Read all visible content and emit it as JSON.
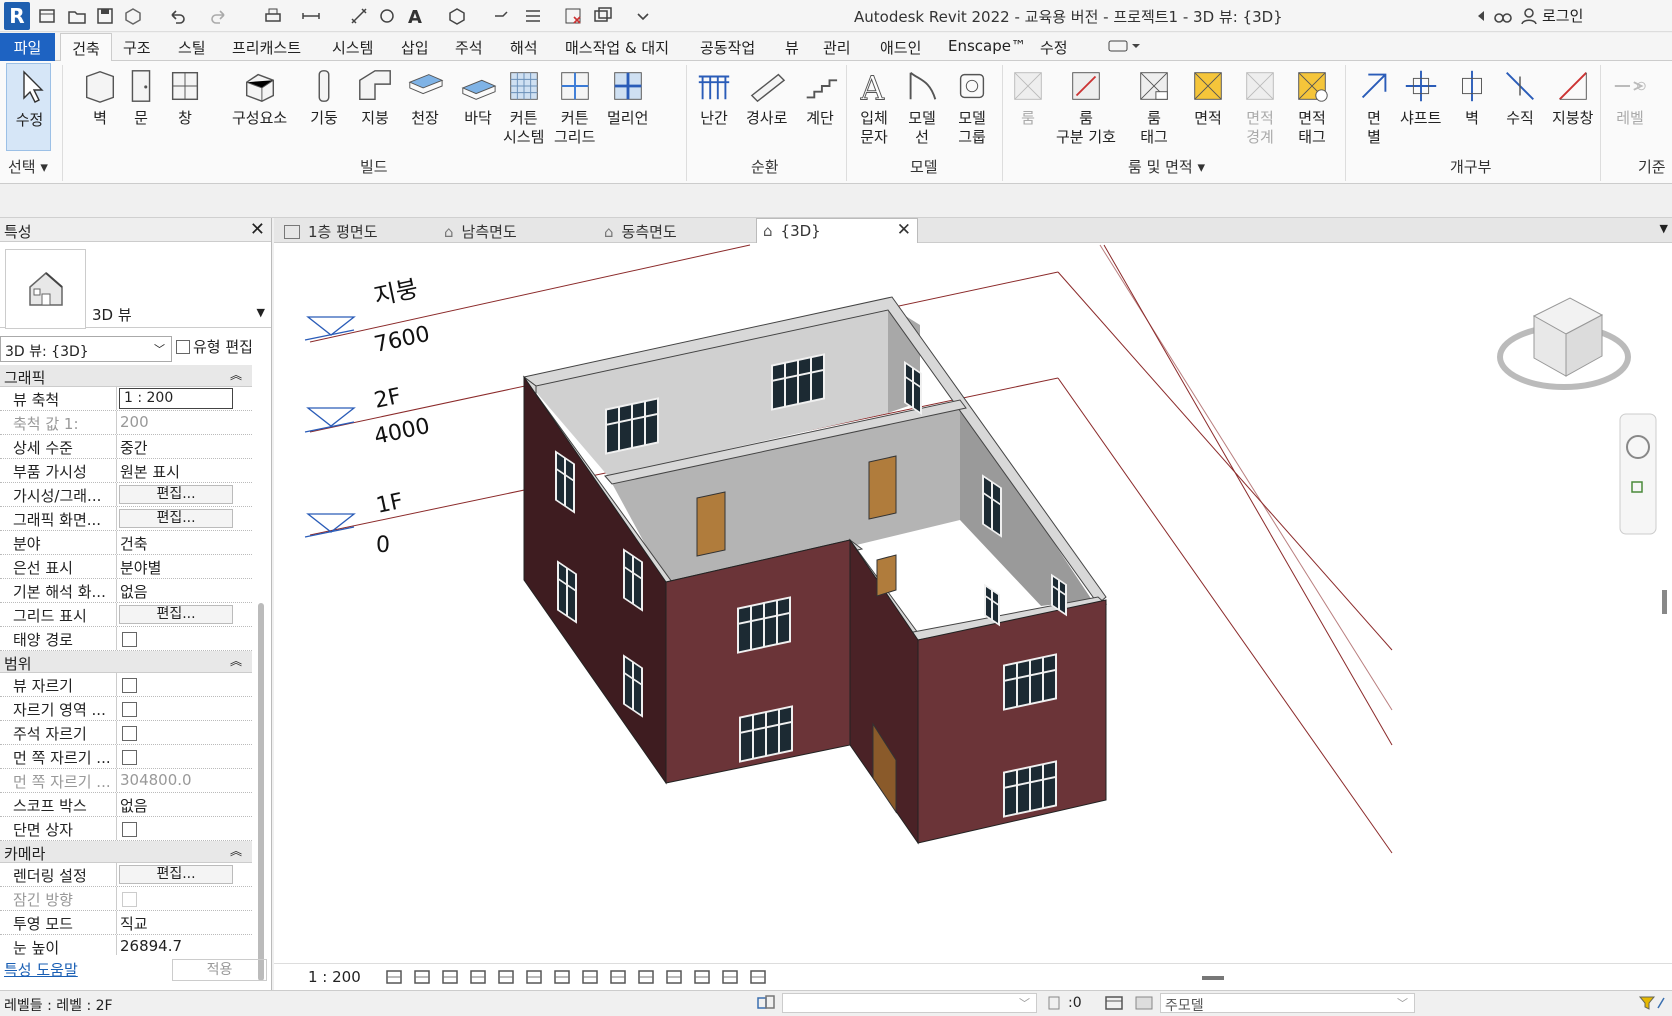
{
  "app": {
    "title": "Autodesk Revit 2022 - 교육용 버전 - 프로젝트1 - 3D 뷰: {3D}",
    "logo_letter": "R",
    "login": "로그인"
  },
  "ribbon_tabs": {
    "file": "파일",
    "active": "건축",
    "items": [
      "구조",
      "스틸",
      "프리캐스트",
      "시스템",
      "삽입",
      "주석",
      "해석",
      "매스작업 & 대지",
      "공동작업",
      "뷰",
      "관리",
      "애드인",
      "Enscape™",
      "수정"
    ]
  },
  "ribbon": {
    "modify": "수정",
    "select_panel": "선택",
    "build": {
      "label": "빌드",
      "buttons": [
        "벽",
        "문",
        "창",
        "구성요소",
        "기둥",
        "지붕",
        "천장",
        "바닥",
        "커튼\n시스템",
        "커튼\n그리드",
        "멀리언"
      ]
    },
    "circulation": {
      "label": "순환",
      "buttons": [
        "난간",
        "경사로",
        "계단"
      ]
    },
    "model": {
      "label": "모델",
      "buttons": [
        "입체\n문자",
        "모델\n선",
        "모델\n그룹"
      ]
    },
    "room_area": {
      "label": "룸 및 면적",
      "buttons": [
        "룸",
        "룸\n구분 기호",
        "룸\n태그",
        "면적",
        "면적\n경계",
        "면적\n태그"
      ]
    },
    "opening": {
      "label": "개구부",
      "buttons": [
        "면\n별",
        "샤프트",
        "벽",
        "수직",
        "지붕창"
      ]
    },
    "datum": {
      "label": "기준",
      "buttons": [
        "레벨"
      ]
    }
  },
  "properties": {
    "title": "특성",
    "type_name": "3D 뷰",
    "view_selector": "3D 뷰: {3D}",
    "edit_type": "유형 편집",
    "sections": {
      "graphics": "그래픽",
      "extents": "범위",
      "camera": "카메라"
    },
    "graphics_rows": [
      {
        "k": "뷰 축척",
        "v": "1 : 200"
      },
      {
        "k": "축척 값    1:",
        "v": "200"
      },
      {
        "k": "상세 수준",
        "v": "중간"
      },
      {
        "k": "부품 가시성",
        "v": "원본 표시"
      },
      {
        "k": "가시성/그래...",
        "v": "편집..."
      },
      {
        "k": "그래픽 화면...",
        "v": "편집..."
      },
      {
        "k": "분야",
        "v": "건축"
      },
      {
        "k": "은선 표시",
        "v": "분야별"
      },
      {
        "k": "기본 해석 화...",
        "v": "없음"
      },
      {
        "k": "그리드 표시",
        "v": "편집..."
      },
      {
        "k": "태양 경로",
        "v": ""
      }
    ],
    "extents_rows": [
      {
        "k": "뷰 자르기",
        "v": ""
      },
      {
        "k": "자르기 영역 ...",
        "v": ""
      },
      {
        "k": "주석 자르기",
        "v": ""
      },
      {
        "k": "먼 쪽 자르기 ...",
        "v": ""
      },
      {
        "k": "먼 쪽 자르기 ...",
        "v": "304800.0"
      },
      {
        "k": "스코프 박스",
        "v": "없음"
      },
      {
        "k": "단면 상자",
        "v": ""
      }
    ],
    "camera_rows": [
      {
        "k": "렌더링 설정",
        "v": "편집..."
      },
      {
        "k": "잠긴 방향",
        "v": ""
      },
      {
        "k": "투영 모드",
        "v": "직교"
      },
      {
        "k": "눈 높이",
        "v": "26894.7"
      }
    ],
    "help_link": "특성 도움말",
    "apply": "적용"
  },
  "view_tabs": [
    "1층 평면도",
    "남측면도",
    "동측면도",
    "{3D}"
  ],
  "levels": [
    {
      "name": "지붕",
      "elev": "7600"
    },
    {
      "name": "2F",
      "elev": "4000"
    },
    {
      "name": "1F",
      "elev": "0"
    }
  ],
  "view_bar": {
    "scale": "1 : 200"
  },
  "status": {
    "text": "레벨들 : 레벨 : 2F",
    "zero": ":0",
    "main_model": "주모델"
  },
  "colors": {
    "accent": "#1e63c2",
    "brick": "#6b3438",
    "brick_dark": "#3e1c20",
    "interior": "#c8c8c8",
    "door": "#b07c3c",
    "level_line": "#8b2a2a",
    "level_marker": "#2a5cb8"
  }
}
